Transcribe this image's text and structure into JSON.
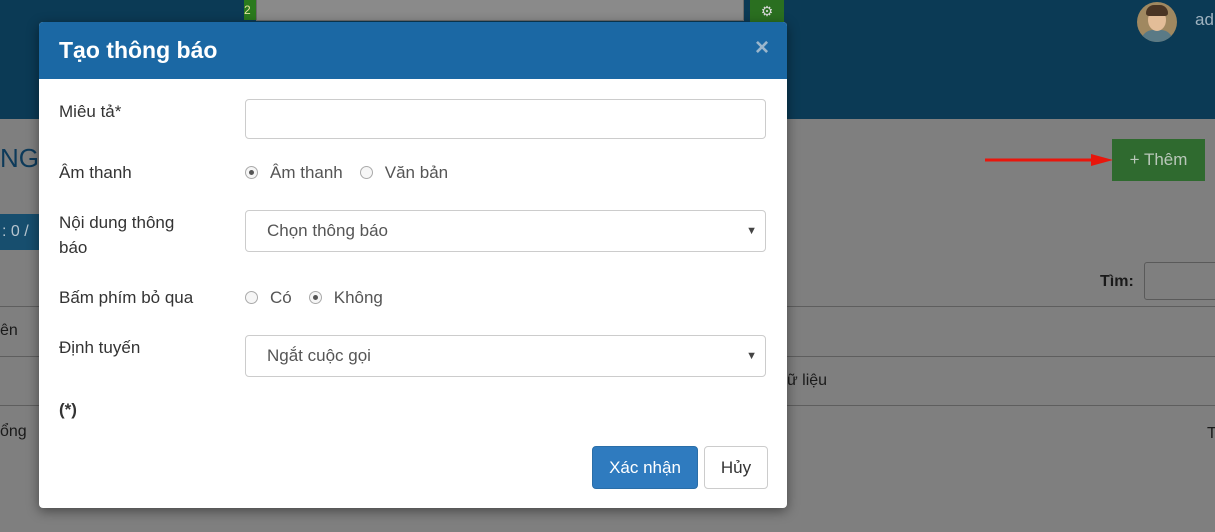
{
  "header": {
    "search_strip_text": "2",
    "gear_icon": "gears-icon",
    "username": "ad"
  },
  "background_page": {
    "heading": "NG I",
    "count_text": ": 0 /",
    "add_button_label": "+ Thêm",
    "search_label": "Tìm:",
    "column_header_partial": "ên",
    "empty_text_partial": "ữ liệu",
    "footer_partial_left": "ổng",
    "footer_partial_right": "T",
    "arrow_color": "#e8160c"
  },
  "modal": {
    "title": "Tạo thông báo",
    "close_symbol": "×",
    "fields": {
      "description": {
        "label": "Miêu tả*",
        "value": ""
      },
      "sound": {
        "label": "Âm thanh",
        "options": [
          "Âm thanh",
          "Văn bản"
        ],
        "selected": "Âm thanh"
      },
      "content": {
        "label_line1": "Nội dung thông",
        "label_line2": "báo",
        "selected": "Chọn thông báo"
      },
      "skip_key": {
        "label": "Bấm phím bỏ qua",
        "options": [
          "Có",
          "Không"
        ],
        "selected": "Không"
      },
      "routing": {
        "label": "Định tuyến",
        "selected": "Ngắt cuộc gọi"
      }
    },
    "required_note": "(*)",
    "confirm_label": "Xác nhận",
    "cancel_label": "Hủy"
  },
  "colors": {
    "modal_header": "#1b68a4",
    "confirm_button": "#2f7bbf",
    "topbar": "#0b3a55",
    "add_button": "#2f6a2f"
  }
}
